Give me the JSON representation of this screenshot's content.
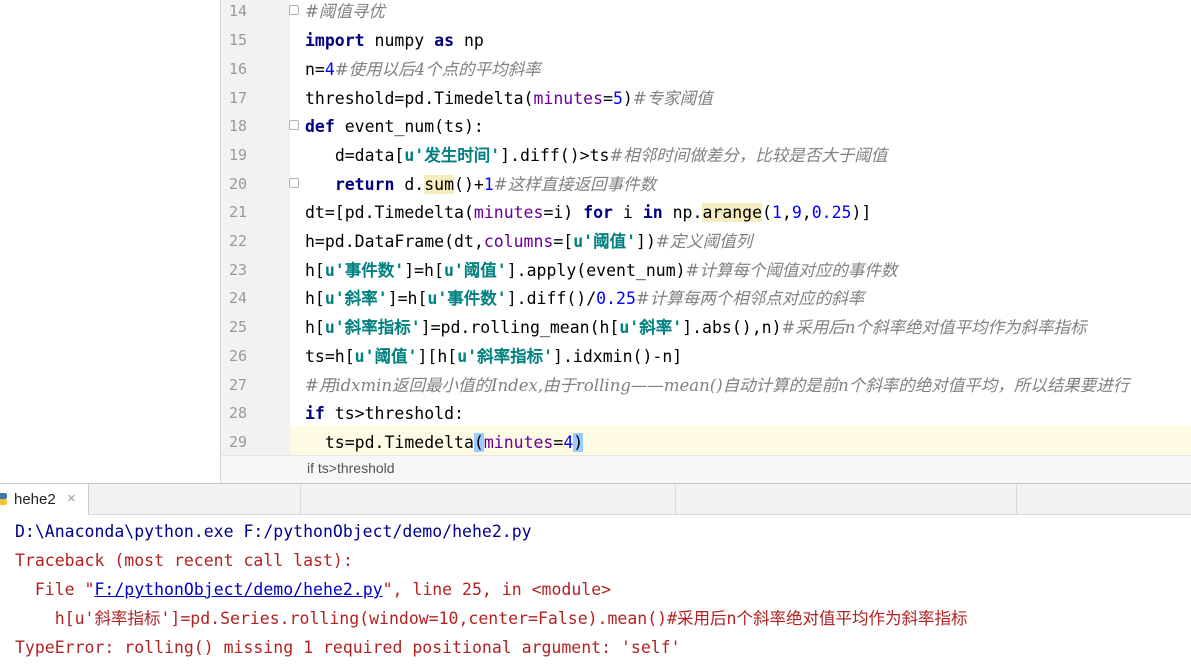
{
  "editor": {
    "line_numbers": [
      "14",
      "15",
      "16",
      "17",
      "18",
      "19",
      "20",
      "21",
      "22",
      "23",
      "24",
      "25",
      "26",
      "27",
      "28",
      "29"
    ],
    "lines": {
      "l14": {
        "cmt": "#阈值寻优"
      },
      "l15": {
        "kw1": "import",
        "mod": " numpy ",
        "kw2": "as",
        "alias": " np"
      },
      "l16": {
        "a": "n=",
        "n": "4",
        "cmt": "#使用以后4个点的平均斜率"
      },
      "l17": {
        "a": "threshold=pd.Timedelta(",
        "p": "minutes",
        "b": "=",
        "n": "5",
        "c": ")",
        "cmt": "#专家阈值"
      },
      "l18": {
        "kw": "def",
        "rest": " event_num(ts):"
      },
      "l19": {
        "indent": "   ",
        "a": "d=data[",
        "s": "u'发生时间'",
        "b": "].diff()>ts",
        "cmt": "#相邻时间做差分，比较是否大于阈值"
      },
      "l20": {
        "indent": "   ",
        "kw": "return",
        "a": " d.",
        "hl": "sum",
        "b": "()+",
        "n": "1",
        "cmt": "#这样直接返回事件数"
      },
      "l21": {
        "a": "dt=[pd.Timedelta(",
        "p": "minutes",
        "b": "=i) ",
        "kw1": "for",
        "c": " i ",
        "kw2": "in",
        "d": " np.",
        "hl": "arange",
        "e": "(",
        "n1": "1",
        "f": ",",
        "n2": "9",
        "g": ",",
        "n3": "0.25",
        "h": ")]"
      },
      "l22": {
        "a": "h=pd.DataFrame(dt,",
        "p": "columns",
        "b": "=[",
        "s": "u'阈值'",
        "c": "])",
        "cmt": "#定义阈值列"
      },
      "l23": {
        "a": "h[",
        "s1": "u'事件数'",
        "b": "]=h[",
        "s2": "u'阈值'",
        "c": "].apply(event_num)",
        "cmt": "#计算每个阈值对应的事件数"
      },
      "l24": {
        "a": "h[",
        "s1": "u'斜率'",
        "b": "]=h[",
        "s2": "u'事件数'",
        "c": "].diff()/",
        "n": "0.25",
        "cmt": "#计算每两个相邻点对应的斜率"
      },
      "l25": {
        "a": "h[",
        "s1": "u'斜率指标'",
        "b": "]=pd.rolling_mean(h[",
        "s2": "u'斜率'",
        "c": "].abs(),n)",
        "cmt": "#采用后n个斜率绝对值平均作为斜率指标"
      },
      "l26": {
        "a": "ts=h[",
        "s1": "u'阈值'",
        "b": "][h[",
        "s2": "u'斜率指标'",
        "c": "].idxmin()-n]"
      },
      "l27": {
        "cmt": "#用idxmin返回最小值的Index,由于rolling——mean()自动计算的是前n个斜率的绝对值平均，所以结果要进行"
      },
      "l28": {
        "kw": "if",
        "rest": " ts>threshold:"
      },
      "l29": {
        "indent": "  ",
        "a": "ts=pd.Timedelta",
        "br1": "(",
        "p": "minutes",
        "b": "=",
        "n": "4",
        "br2": ")"
      }
    },
    "breadcrumb": "if ts>threshold"
  },
  "run_panel": {
    "tab_label": "hehe2",
    "close_glyph": "×"
  },
  "console": {
    "line1": "D:\\Anaconda\\python.exe F:/pythonObject/demo/hehe2.py",
    "line2": "Traceback (most recent call last):",
    "line3": {
      "pre": "  File \"",
      "link": "F:/pythonObject/demo/hehe2.py",
      "post": "\", line 25, in <module>"
    },
    "line4": "    h[u'斜率指标']=pd.Series.rolling(window=10,center=False).mean()#采用后n个斜率绝对值平均作为斜率指标",
    "line5": "TypeError: rolling() missing 1 required positional argument: 'self'"
  },
  "colors": {
    "keyword": "#000080",
    "number": "#0000ff",
    "string": "#008080",
    "comment": "#808080",
    "param": "#660099",
    "error": "#b22222",
    "console_blue": "#00008b"
  }
}
